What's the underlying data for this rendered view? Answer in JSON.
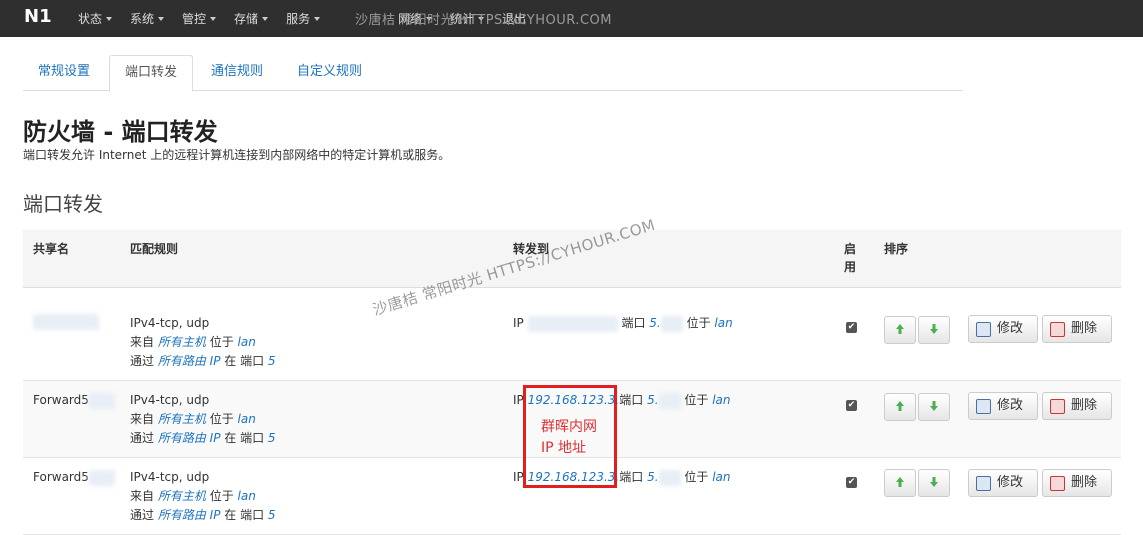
{
  "nav": {
    "brand": "N1",
    "items": [
      "状态",
      "系统",
      "管控",
      "存储",
      "服务",
      "网络",
      "统计",
      "退出"
    ],
    "watermark": "沙唐桔 常阳时光 HTTPS://CYHOUR.COM"
  },
  "tabs": [
    "常规设置",
    "端口转发",
    "通信规则",
    "自定义规则"
  ],
  "page": {
    "title": "防火墙 - 端口转发",
    "description": "端口转发允许 Internet 上的远程计算机连接到内部网络中的特定计算机或服务。",
    "section": "端口转发"
  },
  "table": {
    "headers": {
      "name": "共享名",
      "match": "匹配规则",
      "forward": "转发到",
      "enable": "启用",
      "sort": "排序"
    },
    "rows": [
      {
        "name": "",
        "protocol": "IPv4-tcp, udp",
        "from_prefix": "来自",
        "from_host": "所有主机",
        "from_loc_prefix": "位于",
        "from_zone": "lan",
        "via_prefix": "通过",
        "via_route": "所有路由 IP",
        "via_at": "在 端口",
        "via_port": "5",
        "fwd_ip_prefix": "IP",
        "fwd_ip": "",
        "fwd_port_prefix": "端口",
        "fwd_port": "5.",
        "fwd_loc_prefix": "位于",
        "fwd_zone": "lan"
      },
      {
        "name": "Forward5",
        "protocol": "IPv4-tcp, udp",
        "from_prefix": "来自",
        "from_host": "所有主机",
        "from_loc_prefix": "位于",
        "from_zone": "lan",
        "via_prefix": "通过",
        "via_route": "所有路由 IP",
        "via_at": "在 端口",
        "via_port": "5",
        "fwd_ip_prefix": "IP",
        "fwd_ip": "192.168.123.3,",
        "fwd_port_prefix": "端口",
        "fwd_port": "5.",
        "fwd_loc_prefix": "位于",
        "fwd_zone": "lan"
      },
      {
        "name": "Forward5",
        "protocol": "IPv4-tcp, udp",
        "from_prefix": "来自",
        "from_host": "所有主机",
        "from_loc_prefix": "位于",
        "from_zone": "lan",
        "via_prefix": "通过",
        "via_route": "所有路由 IP",
        "via_at": "在 端口",
        "via_port": "5",
        "fwd_ip_prefix": "IP",
        "fwd_ip": "192.168.123.3,",
        "fwd_port_prefix": "端口",
        "fwd_port": "5.",
        "fwd_loc_prefix": "位于",
        "fwd_zone": "lan"
      }
    ],
    "edit_label": "修改",
    "delete_label": "删除",
    "check_glyph": "✔"
  },
  "overlay": {
    "watermark": "沙唐桔 常阳时光 HTTPS://CYHOUR.COM",
    "annotation_line1": "群晖内网",
    "annotation_line2": "IP 地址"
  },
  "colors": {
    "navbar": "#2f2f2f",
    "link": "#1e73be",
    "annotation": "#e02020"
  }
}
